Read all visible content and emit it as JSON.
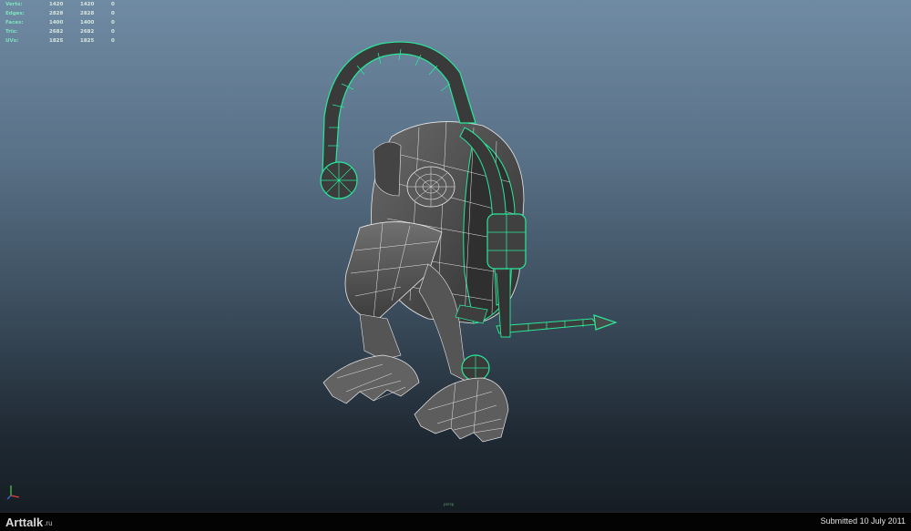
{
  "stats": [
    {
      "label": "Verts:",
      "v1": "1420",
      "v2": "1420",
      "v3": "0"
    },
    {
      "label": "Edges:",
      "v1": "2828",
      "v2": "2828",
      "v3": "0"
    },
    {
      "label": "Faces:",
      "v1": "1400",
      "v2": "1400",
      "v3": "0"
    },
    {
      "label": "Tris:",
      "v1": "2682",
      "v2": "2682",
      "v3": "0"
    },
    {
      "label": "UVs:",
      "v1": "1825",
      "v2": "1825",
      "v3": "0"
    }
  ],
  "viewport": {
    "camera_label": "persp"
  },
  "footer": {
    "brand_pre": "",
    "brand_name": "Arttalk",
    "brand_domain": ".ru",
    "submitted": "Submitted 10 July 2011"
  },
  "colors": {
    "wire_selected": "#28e89a",
    "mesh_fill": "#4a4a4a",
    "wire": "#e8e8e8",
    "brand_accent": "#e05a1a"
  },
  "icons": {
    "axis": "xyz-axis-gizmo"
  }
}
